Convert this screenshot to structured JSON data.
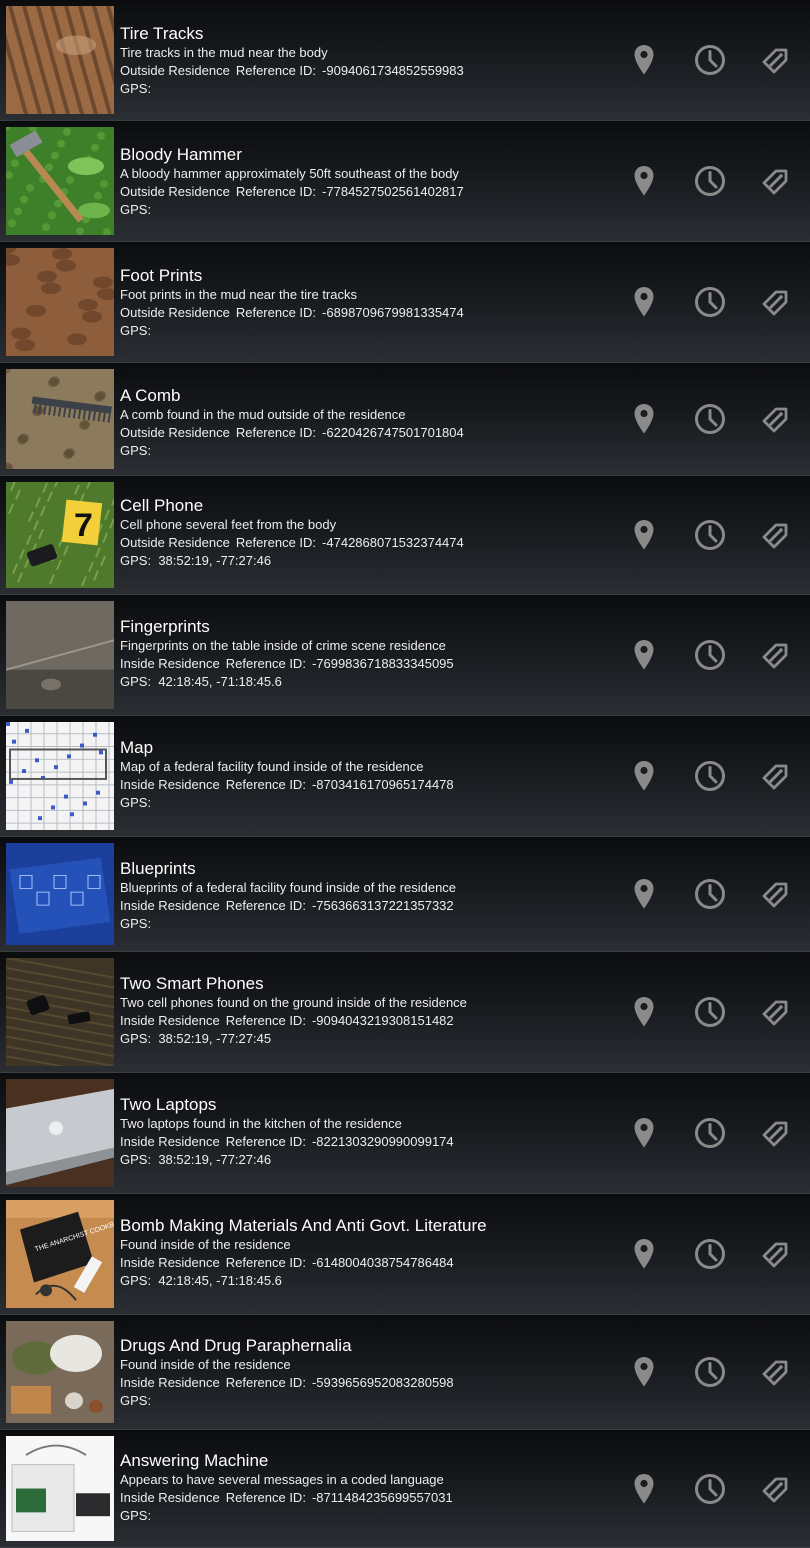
{
  "labels": {
    "reference": "Reference ID:",
    "gps": "GPS:"
  },
  "icons": [
    "map-pin-icon",
    "clock-icon",
    "edit-tag-icon"
  ],
  "colors": {
    "icon": "#8a8a8a",
    "text": "#ffffff"
  },
  "items": [
    {
      "title": "Tire Tracks",
      "description": "Tire tracks in the mud near the body",
      "location": "Outside Residence",
      "reference": "-9094061734852559983",
      "gps": "",
      "thumb": "tire-tracks"
    },
    {
      "title": "Bloody Hammer",
      "description": "A bloody hammer approximately 50ft southeast of the body",
      "location": "Outside Residence",
      "reference": "-7784527502561402817",
      "gps": "",
      "thumb": "hammer"
    },
    {
      "title": "Foot Prints",
      "description": "Foot prints in the mud near the tire tracks",
      "location": "Outside Residence",
      "reference": "-6898709679981335474",
      "gps": "",
      "thumb": "footprints"
    },
    {
      "title": "A Comb",
      "description": "A comb found in the mud outside of the residence",
      "location": "Outside Residence",
      "reference": "-6220426747501701804",
      "gps": "",
      "thumb": "comb"
    },
    {
      "title": "Cell Phone",
      "description": "Cell phone several feet from the body",
      "location": "Outside Residence",
      "reference": "-4742868071532374474",
      "gps": "38:52:19, -77:27:46",
      "thumb": "cell-phone"
    },
    {
      "title": "Fingerprints",
      "description": "Fingerprints on the table inside of crime scene residence",
      "location": "Inside Residence",
      "reference": "-7699836718833345095",
      "gps": "42:18:45, -71:18:45.6",
      "thumb": "fingerprints"
    },
    {
      "title": "Map",
      "description": "Map of a federal facility found inside of the residence",
      "location": "Inside Residence",
      "reference": "-8703416170965174478",
      "gps": "",
      "thumb": "map"
    },
    {
      "title": "Blueprints",
      "description": "Blueprints of a federal facility found inside of the residence",
      "location": "Inside Residence",
      "reference": "-7563663137221357332",
      "gps": "",
      "thumb": "blueprints"
    },
    {
      "title": "Two Smart Phones",
      "description": "Two cell phones found on the ground inside of the residence",
      "location": "Inside Residence",
      "reference": "-9094043219308151482",
      "gps": "38:52:19, -77:27:45",
      "thumb": "two-phones"
    },
    {
      "title": "Two Laptops",
      "description": "Two laptops found in the kitchen of the residence",
      "location": "Inside Residence",
      "reference": "-8221303290990099174",
      "gps": "38:52:19, -77:27:46",
      "thumb": "laptops"
    },
    {
      "title": "Bomb Making Materials And Anti Govt. Literature",
      "description": "Found inside of the residence",
      "location": "Inside Residence",
      "reference": "-6148004038754786484",
      "gps": "42:18:45, -71:18:45.6",
      "thumb": "bomb",
      "thumb_text": "THE ANARCHIST COOKBOOK"
    },
    {
      "title": "Drugs And Drug Paraphernalia",
      "description": "Found inside of the residence",
      "location": "Inside Residence",
      "reference": "-5939656952083280598",
      "gps": "",
      "thumb": "drugs"
    },
    {
      "title": "Answering Machine",
      "description": "Appears to have several messages in a coded language",
      "location": "Inside Residence",
      "reference": "-8711484235699557031",
      "gps": "",
      "thumb": "answering-machine"
    }
  ]
}
